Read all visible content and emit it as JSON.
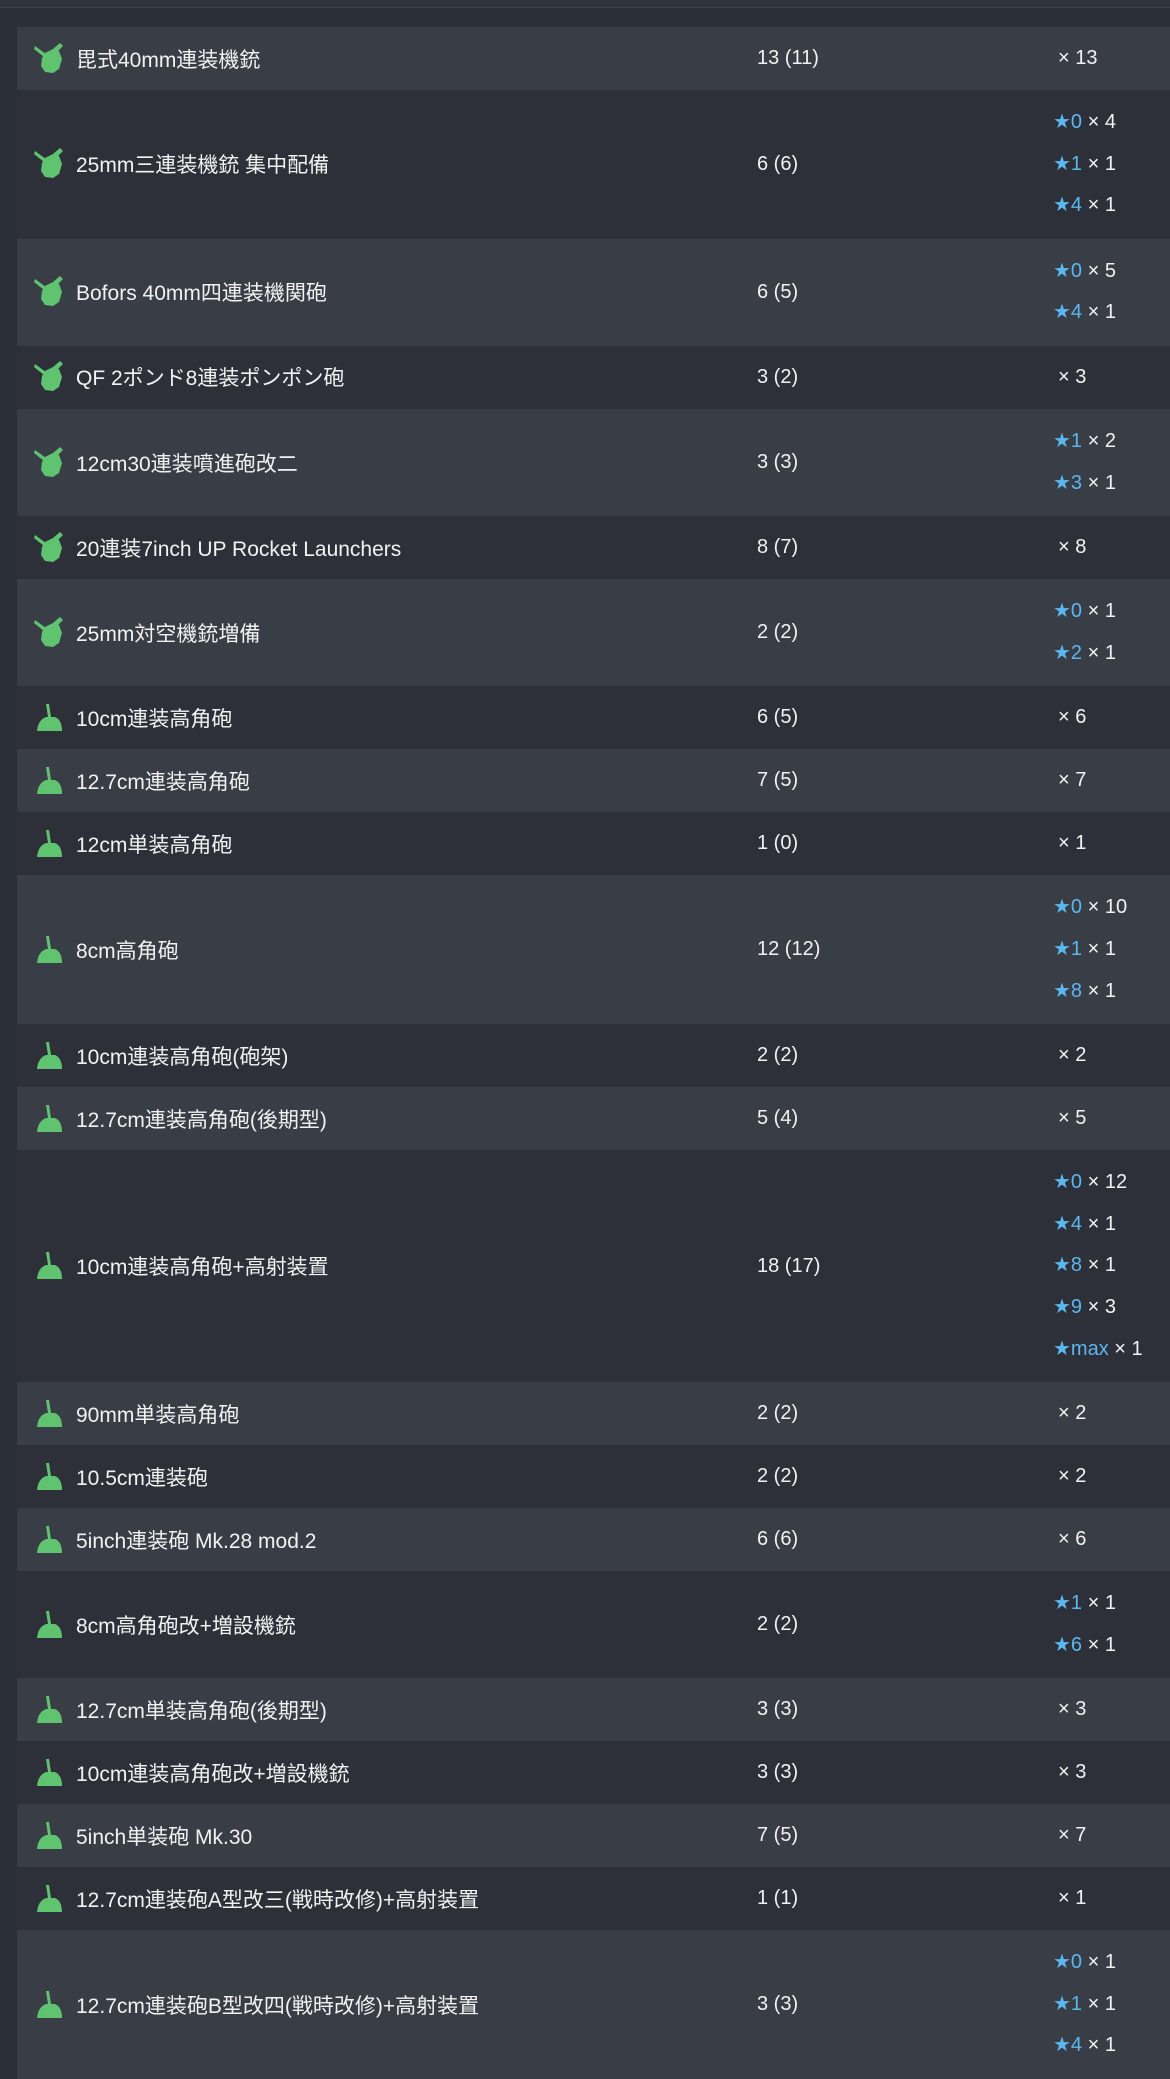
{
  "colors": {
    "page_bg": "#2b2f38",
    "row_odd": "#393d46",
    "row_even": "#2d3039",
    "text": "#f2f2f2",
    "star": "#5bb7ef",
    "icon_green": "#5fc36f"
  },
  "rows": [
    {
      "name": "毘式40mm連装機銃",
      "count": "13 (11)",
      "icon": "aa-gun-icon",
      "stars": [],
      "plain": "× 13"
    },
    {
      "name": "25mm三連装機銃 集中配備",
      "count": "6 (6)",
      "icon": "aa-gun-icon",
      "stars": [
        {
          "star": "★0",
          "mult": "× 4"
        },
        {
          "star": "★1",
          "mult": "× 1"
        },
        {
          "star": "★4",
          "mult": "× 1"
        }
      ]
    },
    {
      "name": "Bofors 40mm四連装機関砲",
      "count": "6 (5)",
      "icon": "aa-gun-icon",
      "stars": [
        {
          "star": "★0",
          "mult": "× 5"
        },
        {
          "star": "★4",
          "mult": "× 1"
        }
      ]
    },
    {
      "name": "QF 2ポンド8連装ポンポン砲",
      "count": "3 (2)",
      "icon": "aa-gun-icon",
      "stars": [],
      "plain": "× 3"
    },
    {
      "name": "12cm30連装噴進砲改二",
      "count": "3 (3)",
      "icon": "aa-gun-icon",
      "stars": [
        {
          "star": "★1",
          "mult": "× 2"
        },
        {
          "star": "★3",
          "mult": "× 1"
        }
      ]
    },
    {
      "name": "20連装7inch UP Rocket Launchers",
      "count": "8 (7)",
      "icon": "aa-gun-icon",
      "stars": [],
      "plain": "× 8"
    },
    {
      "name": "25mm対空機銃増備",
      "count": "2 (2)",
      "icon": "aa-gun-icon",
      "stars": [
        {
          "star": "★0",
          "mult": "× 1"
        },
        {
          "star": "★2",
          "mult": "× 1"
        }
      ]
    },
    {
      "name": "10cm連装高角砲",
      "count": "6 (5)",
      "icon": "high-angle-gun-icon",
      "stars": [],
      "plain": "× 6"
    },
    {
      "name": "12.7cm連装高角砲",
      "count": "7 (5)",
      "icon": "high-angle-gun-icon",
      "stars": [],
      "plain": "× 7"
    },
    {
      "name": "12cm単装高角砲",
      "count": "1 (0)",
      "icon": "high-angle-gun-icon",
      "stars": [],
      "plain": "× 1"
    },
    {
      "name": "8cm高角砲",
      "count": "12 (12)",
      "icon": "high-angle-gun-icon",
      "stars": [
        {
          "star": "★0",
          "mult": "× 10"
        },
        {
          "star": "★1",
          "mult": "× 1"
        },
        {
          "star": "★8",
          "mult": "× 1"
        }
      ]
    },
    {
      "name": "10cm連装高角砲(砲架)",
      "count": "2 (2)",
      "icon": "high-angle-gun-icon",
      "stars": [],
      "plain": "× 2"
    },
    {
      "name": "12.7cm連装高角砲(後期型)",
      "count": "5 (4)",
      "icon": "high-angle-gun-icon",
      "stars": [],
      "plain": "× 5"
    },
    {
      "name": "10cm連装高角砲+高射装置",
      "count": "18 (17)",
      "icon": "high-angle-gun-icon",
      "stars": [
        {
          "star": "★0",
          "mult": "× 12"
        },
        {
          "star": "★4",
          "mult": "× 1"
        },
        {
          "star": "★8",
          "mult": "× 1"
        },
        {
          "star": "★9",
          "mult": "× 3"
        },
        {
          "star": "★max",
          "mult": "× 1"
        }
      ]
    },
    {
      "name": "90mm単装高角砲",
      "count": "2 (2)",
      "icon": "high-angle-gun-icon",
      "stars": [],
      "plain": "× 2"
    },
    {
      "name": "10.5cm連装砲",
      "count": "2 (2)",
      "icon": "high-angle-gun-icon",
      "stars": [],
      "plain": "× 2"
    },
    {
      "name": "5inch連装砲 Mk.28 mod.2",
      "count": "6 (6)",
      "icon": "high-angle-gun-icon",
      "stars": [],
      "plain": "× 6"
    },
    {
      "name": "8cm高角砲改+増設機銃",
      "count": "2 (2)",
      "icon": "high-angle-gun-icon",
      "stars": [
        {
          "star": "★1",
          "mult": "× 1"
        },
        {
          "star": "★6",
          "mult": "× 1"
        }
      ]
    },
    {
      "name": "12.7cm単装高角砲(後期型)",
      "count": "3 (3)",
      "icon": "high-angle-gun-icon",
      "stars": [],
      "plain": "× 3"
    },
    {
      "name": "10cm連装高角砲改+増設機銃",
      "count": "3 (3)",
      "icon": "high-angle-gun-icon",
      "stars": [],
      "plain": "× 3"
    },
    {
      "name": "5inch単装砲 Mk.30",
      "count": "7 (5)",
      "icon": "high-angle-gun-icon",
      "stars": [],
      "plain": "× 7"
    },
    {
      "name": "12.7cm連装砲A型改三(戦時改修)+高射装置",
      "count": "1 (1)",
      "icon": "high-angle-gun-icon",
      "stars": [],
      "plain": "× 1"
    },
    {
      "name": "12.7cm連装砲B型改四(戦時改修)+高射装置",
      "count": "3 (3)",
      "icon": "high-angle-gun-icon",
      "stars": [
        {
          "star": "★0",
          "mult": "× 1"
        },
        {
          "star": "★1",
          "mult": "× 1"
        },
        {
          "star": "★4",
          "mult": "× 1"
        }
      ]
    }
  ]
}
